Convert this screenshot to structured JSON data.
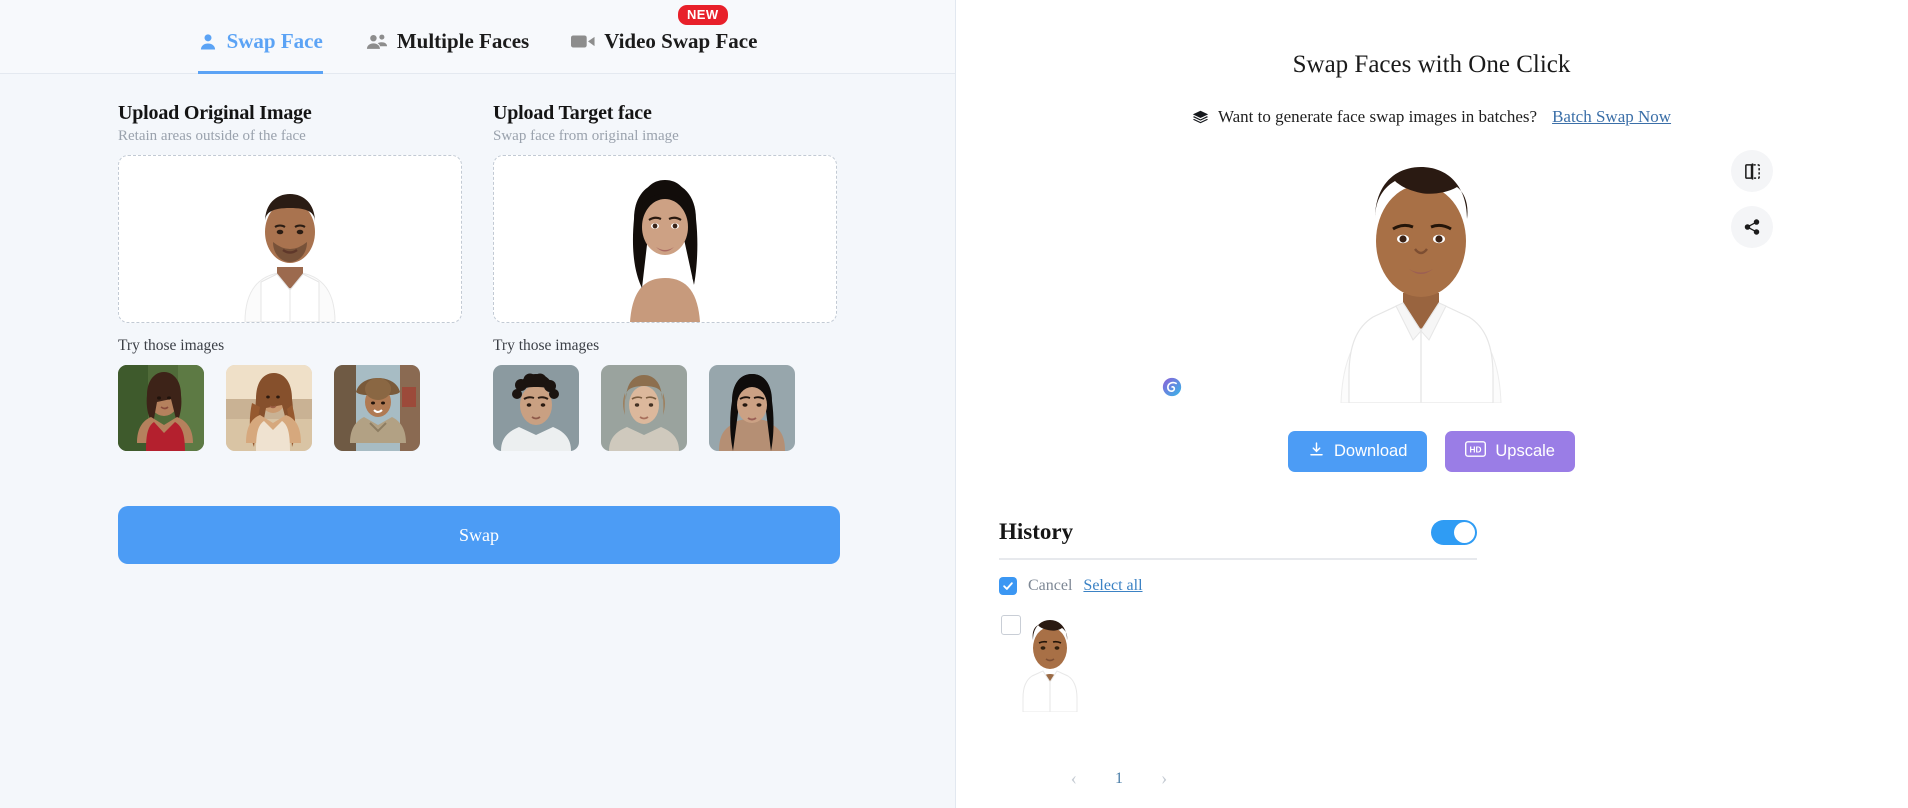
{
  "tabs": [
    {
      "label": "Swap Face",
      "icon": "person-icon",
      "active": true,
      "badge": null
    },
    {
      "label": "Multiple Faces",
      "icon": "people-icon",
      "active": false,
      "badge": null
    },
    {
      "label": "Video Swap Face",
      "icon": "video-camera-icon",
      "active": false,
      "badge": "NEW"
    }
  ],
  "left": {
    "original": {
      "title": "Upload Original Image",
      "subtitle": "Retain areas outside of the face",
      "try_label": "Try those images",
      "thumbs": [
        "woman-red-dress-garden",
        "woman-golden-hour-beach",
        "man-cowboy-hat"
      ]
    },
    "target": {
      "title": "Upload Target face",
      "subtitle": "Swap face from original image",
      "try_label": "Try those images",
      "thumbs": [
        "man-curly-hair",
        "woman-light-hair",
        "woman-dark-hair"
      ]
    },
    "swap_button": "Swap"
  },
  "right": {
    "title": "Swap Faces with One Click",
    "batch_text": "Want to generate face swap images in batches?",
    "batch_link": "Batch Swap Now",
    "batch_icon": "layers-stack-icon",
    "side_buttons": [
      {
        "name": "compare-split-view-icon"
      },
      {
        "name": "share-icon"
      }
    ],
    "watermark": "app-logo-watermark",
    "actions": [
      {
        "label": "Download",
        "icon": "download-icon",
        "color": "#4c9cf5"
      },
      {
        "label": "Upscale",
        "icon": "hd-icon",
        "color": "#9a7de6"
      }
    ],
    "history": {
      "title": "History",
      "toggle_on": true,
      "cancel_label": "Cancel",
      "select_all_label": "Select all",
      "checkbox_checked": true,
      "items": [
        {
          "name": "swapped-result-thumbnail",
          "selected": false
        }
      ]
    },
    "pagination": {
      "prev": "‹",
      "page": "1",
      "next": "›"
    }
  },
  "colors": {
    "accent_blue": "#4c9cf5",
    "accent_purple": "#9a7de6",
    "badge_red": "#e8202a",
    "panel_bg": "#f4f7fb",
    "link": "#3b6fa8"
  }
}
